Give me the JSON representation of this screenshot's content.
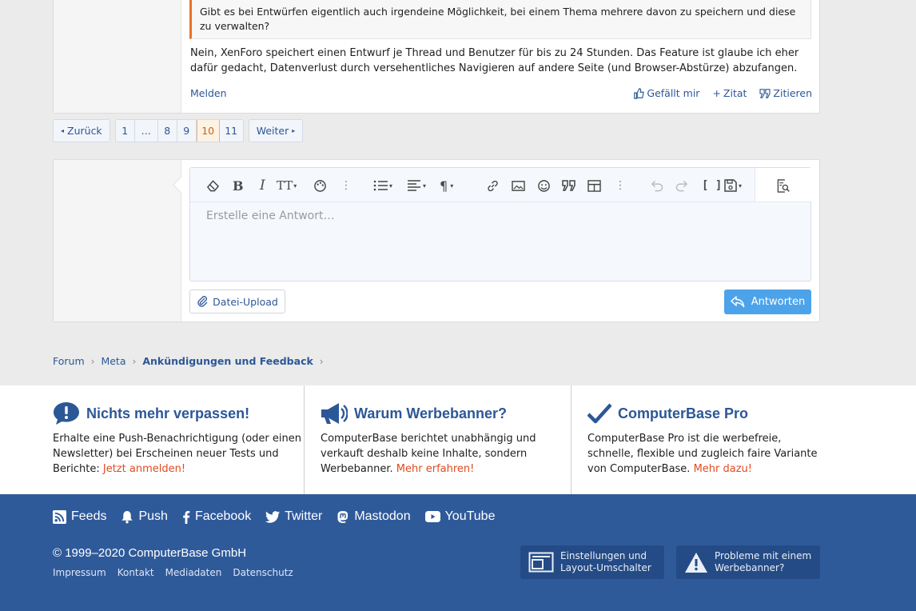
{
  "post": {
    "quote_text": "Gibt es bei Entwürfen eigentlich auch irgendeine Möglichkeit, bei einem Thema mehrere davon zu speichern und diese zu verwalten?",
    "body_text": "Nein, XenForo speichert einen Entwurf je Thread und Benutzer für bis zu 24 Stunden. Das Feature ist glaube ich eher dafür gedacht, Datenverlust durch versehentliches Navigieren auf andere Seite (und Browser-Abstürze) abzufangen.",
    "report_label": "Melden",
    "like_label": "Gefällt mir",
    "quote_label": "Zitat",
    "reply_quote_label": "Zitieren"
  },
  "pagination": {
    "prev_label": "Zurück",
    "next_label": "Weiter",
    "pages": [
      "1",
      "…",
      "8",
      "9",
      "10",
      "11"
    ],
    "current": "10"
  },
  "editor": {
    "placeholder": "Erstelle eine Antwort…",
    "toolbar": [
      "eraser-icon",
      "bold-icon",
      "italic-icon",
      "text-size-icon",
      "palette-icon",
      "more-icon",
      "list-icon",
      "align-icon",
      "paragraph-icon",
      "link-icon",
      "image-icon",
      "smiley-icon",
      "quote-icon",
      "table-icon",
      "more-icon",
      "undo-icon",
      "redo-icon",
      "bbcode-icon",
      "draft-icon",
      "preview-icon"
    ],
    "upload_label": "Datei-Upload",
    "submit_label": "Antworten"
  },
  "breadcrumb": {
    "items": [
      "Forum",
      "Meta",
      "Ankündigungen und Feedback"
    ]
  },
  "info": {
    "col1": {
      "title": "Nichts mehr verpassen!",
      "text": "Erhalte eine Push-Benachrichtigung (oder einen Newsletter) bei Erscheinen neuer Tests und Berichte: ",
      "link": "Jetzt anmelden!"
    },
    "col2": {
      "title": "Warum Werbebanner?",
      "text": "ComputerBase berichtet unabhängig und verkauft deshalb keine Inhalte, sondern Werbebanner. ",
      "link": "Mehr erfahren!"
    },
    "col3": {
      "title": "ComputerBase Pro",
      "text": "ComputerBase Pro ist die werbefreie, schnelle, flexible und zugleich faire Variante von ComputerBase. ",
      "link": "Mehr dazu!"
    }
  },
  "footer": {
    "social": [
      "Feeds",
      "Push",
      "Facebook",
      "Twitter",
      "Mastodon",
      "YouTube"
    ],
    "copyright": "© 1999–2020 ComputerBase GmbH",
    "links": [
      "Impressum",
      "Kontakt",
      "Mediadaten",
      "Datenschutz"
    ],
    "settings_label_1": "Einstellungen und",
    "settings_label_2": "Layout-Umschalter",
    "problems_label_1": "Probleme mit einem",
    "problems_label_2": "Werbebanner?"
  },
  "colors": {
    "brand": "#2f5a9a",
    "link": "#2c5797",
    "accent": "#e24a1f",
    "button": "#4da3ea"
  }
}
